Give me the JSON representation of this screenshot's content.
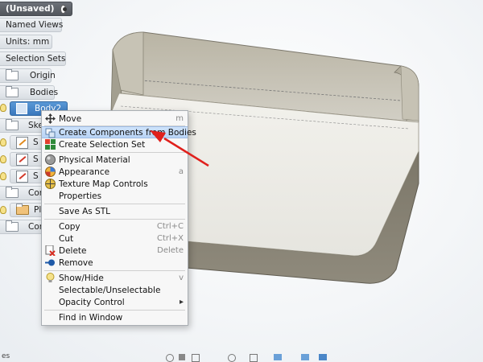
{
  "browser": {
    "doc_title": "(Unsaved)",
    "named_views": "Named Views",
    "units": "Units: mm",
    "selection_sets": "Selection Sets",
    "origin": "Origin",
    "bodies": "Bodies",
    "body2": "Body2",
    "sketches": "Sketc",
    "sketch_rows": [
      "S",
      "S",
      "S"
    ],
    "construction": "Constru",
    "plane": "Plan",
    "components": "Compone"
  },
  "context_menu": {
    "items": [
      {
        "label": "Move",
        "shortcut": "m"
      },
      {
        "label": "Create Components from Bodies",
        "shortcut": ""
      },
      {
        "label": "Create Selection Set",
        "shortcut": ""
      },
      {
        "label": "Physical Material",
        "shortcut": ""
      },
      {
        "label": "Appearance",
        "shortcut": "a"
      },
      {
        "label": "Texture Map Controls",
        "shortcut": ""
      },
      {
        "label": "Properties",
        "shortcut": ""
      },
      {
        "label": "Save As STL",
        "shortcut": ""
      },
      {
        "label": "Copy",
        "shortcut": "Ctrl+C"
      },
      {
        "label": "Cut",
        "shortcut": "Ctrl+X"
      },
      {
        "label": "Delete",
        "shortcut": "Delete"
      },
      {
        "label": "Remove",
        "shortcut": ""
      },
      {
        "label": "Show/Hide",
        "shortcut": "v"
      },
      {
        "label": "Selectable/Unselectable",
        "shortcut": ""
      },
      {
        "label": "Opacity Control",
        "shortcut": ""
      },
      {
        "label": "Find in Window",
        "shortcut": ""
      }
    ],
    "highlighted": "Create Components from Bodies",
    "submenu_arrow": "▸"
  },
  "colors": {
    "annotation_arrow": "#e0201c",
    "highlight": "#c3dbf8",
    "body_dark": "#8b8577",
    "body_light": "#e9e8e2"
  },
  "status_bar": {
    "left_text": "es"
  }
}
